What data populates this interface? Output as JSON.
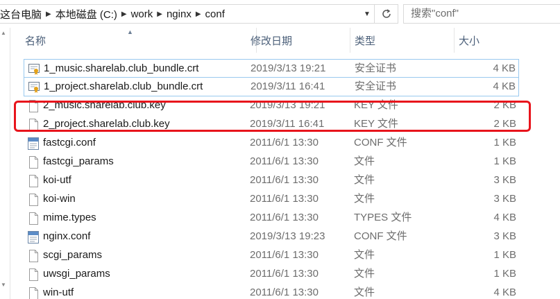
{
  "address_bar": {
    "crumbs": [
      "这台电脑",
      "本地磁盘 (C:)",
      "work",
      "nginx",
      "conf"
    ],
    "search_placeholder": "搜索\"conf\""
  },
  "columns": {
    "name": "名称",
    "date": "修改日期",
    "type": "类型",
    "size": "大小"
  },
  "files": [
    {
      "name": "1_music.sharelab.club_bundle.crt",
      "date": "2019/3/13 19:21",
      "type": "安全证书",
      "size": "4 KB",
      "icon": "certificate-icon",
      "selected": true
    },
    {
      "name": "1_project.sharelab.club_bundle.crt",
      "date": "2019/3/11 16:41",
      "type": "安全证书",
      "size": "4 KB",
      "icon": "certificate-icon",
      "selected": true
    },
    {
      "name": "2_music.sharelab.club.key",
      "date": "2019/3/13 19:21",
      "type": "KEY 文件",
      "size": "2 KB",
      "icon": "file-icon",
      "selected": false
    },
    {
      "name": "2_project.sharelab.club.key",
      "date": "2019/3/11 16:41",
      "type": "KEY 文件",
      "size": "2 KB",
      "icon": "file-icon",
      "selected": false
    },
    {
      "name": "fastcgi.conf",
      "date": "2011/6/1 13:30",
      "type": "CONF 文件",
      "size": "1 KB",
      "icon": "conf-file-icon",
      "selected": false
    },
    {
      "name": "fastcgi_params",
      "date": "2011/6/1 13:30",
      "type": "文件",
      "size": "1 KB",
      "icon": "file-icon",
      "selected": false
    },
    {
      "name": "koi-utf",
      "date": "2011/6/1 13:30",
      "type": "文件",
      "size": "3 KB",
      "icon": "file-icon",
      "selected": false
    },
    {
      "name": "koi-win",
      "date": "2011/6/1 13:30",
      "type": "文件",
      "size": "3 KB",
      "icon": "file-icon",
      "selected": false
    },
    {
      "name": "mime.types",
      "date": "2011/6/1 13:30",
      "type": "TYPES 文件",
      "size": "4 KB",
      "icon": "file-icon",
      "selected": false
    },
    {
      "name": "nginx.conf",
      "date": "2019/3/13 19:23",
      "type": "CONF 文件",
      "size": "3 KB",
      "icon": "conf-file-icon",
      "selected": false
    },
    {
      "name": "scgi_params",
      "date": "2011/6/1 13:30",
      "type": "文件",
      "size": "1 KB",
      "icon": "file-icon",
      "selected": false
    },
    {
      "name": "uwsgi_params",
      "date": "2011/6/1 13:30",
      "type": "文件",
      "size": "1 KB",
      "icon": "file-icon",
      "selected": false
    },
    {
      "name": "win-utf",
      "date": "2011/6/1 13:30",
      "type": "文件",
      "size": "4 KB",
      "icon": "file-icon",
      "selected": false
    }
  ],
  "colors": {
    "selection_border": "#99c9ef",
    "highlight_annotation": "#e8141c",
    "header_text": "#4c607a"
  }
}
